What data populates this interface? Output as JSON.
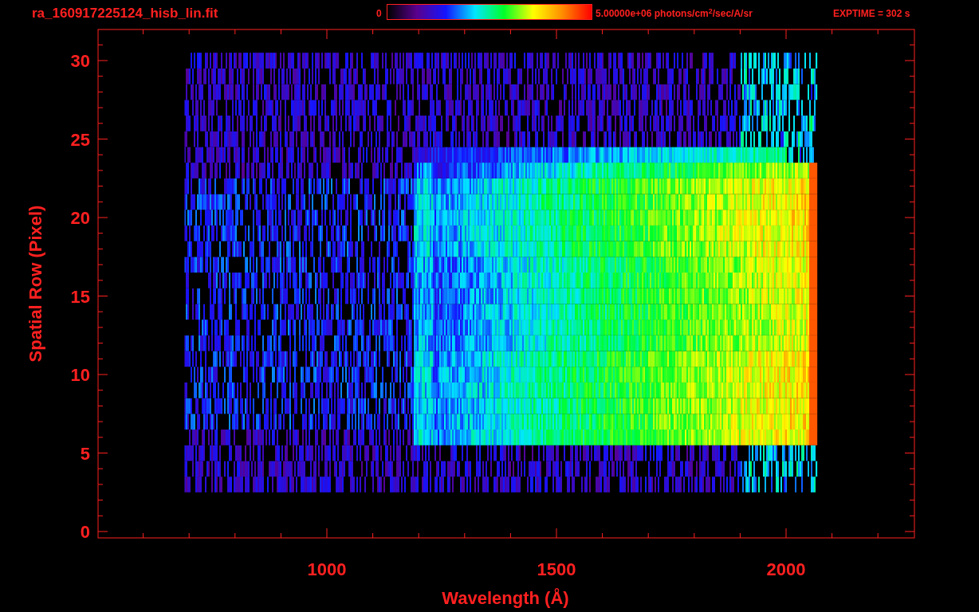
{
  "title": "ra_160917225124_hisb_lin.fit",
  "colorbar": {
    "min_label": "0",
    "max_label": "5.00000e+06 photons/cm$^{2}$/sec/A/sr"
  },
  "exposure": "EXPTIME = 302 s",
  "plot": {
    "xlabel": "Wavelength (Å)",
    "ylabel": "Spatial Row (Pixel)",
    "xticks": [
      "1000",
      "1500",
      "2000"
    ],
    "yticks": [
      "30",
      "25",
      "20",
      "15",
      "10",
      "5",
      "0"
    ]
  }
}
